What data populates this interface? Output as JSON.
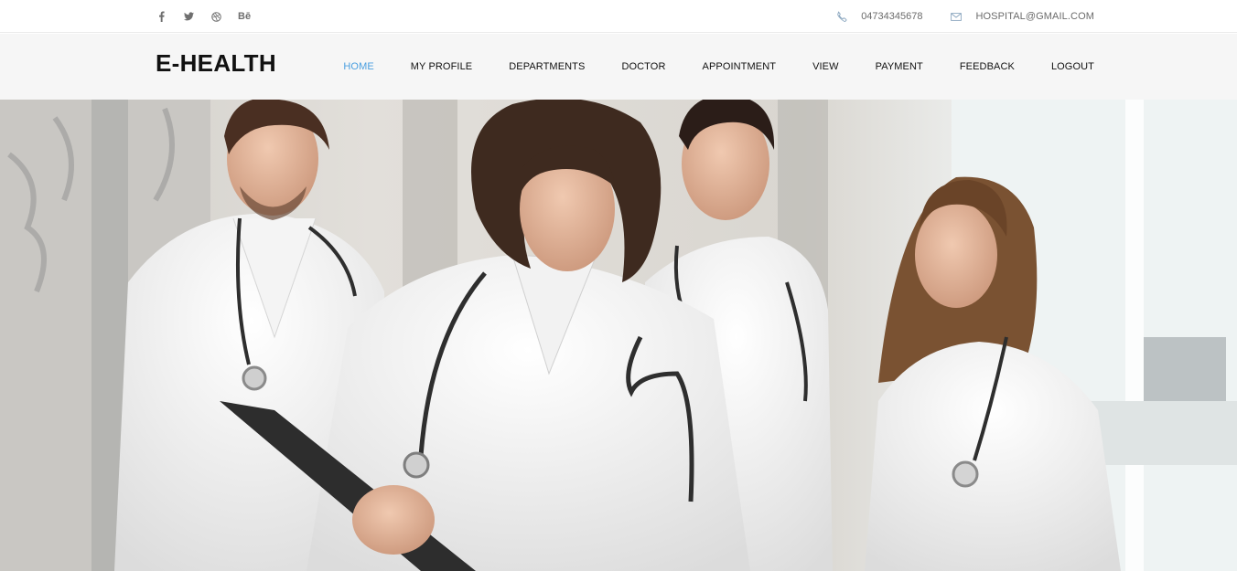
{
  "topbar": {
    "social": [
      {
        "icon": "facebook-icon",
        "glyph": "f"
      },
      {
        "icon": "twitter-icon",
        "glyph": "🐦"
      },
      {
        "icon": "dribbble-icon",
        "glyph": "◎"
      },
      {
        "icon": "behance-icon",
        "glyph": "Bē"
      }
    ],
    "phone": "04734345678",
    "email": "HOSPITAL@GMAIL.COM"
  },
  "nav": {
    "brand": "E-HEALTH",
    "items": [
      {
        "label": "HOME",
        "active": true
      },
      {
        "label": "MY PROFILE"
      },
      {
        "label": "DEPARTMENTS"
      },
      {
        "label": "DOCTOR"
      },
      {
        "label": "APPOINTMENT"
      },
      {
        "label": "VIEW"
      },
      {
        "label": "PAYMENT"
      },
      {
        "label": "FEEDBACK"
      },
      {
        "label": "LOGOUT"
      }
    ]
  },
  "colors": {
    "accent": "#4a9fe0",
    "nav_bg": "#f6f6f6",
    "text": "#111111",
    "muted": "#6b6b6b"
  }
}
